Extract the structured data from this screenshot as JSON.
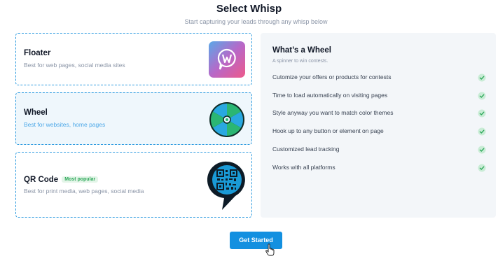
{
  "header": {
    "title": "Select Whisp",
    "subtitle": "Start capturing your leads through any whisp below"
  },
  "options": [
    {
      "title": "Floater",
      "description": "Best for web pages, social media sites",
      "icon": "floater-icon",
      "selected": false
    },
    {
      "title": "Wheel",
      "description": "Best for websites, home pages",
      "icon": "wheel-icon",
      "selected": true
    },
    {
      "title": "QR Code",
      "badge": "Most popular",
      "description": "Best for print media, web pages, social media",
      "icon": "qr-code-icon",
      "selected": false
    }
  ],
  "details": {
    "title": "What’s a Wheel",
    "subtitle": "A spinner to win contests.",
    "features": [
      "Cutomize your offers or products for contests",
      "Time to load automatically on visiting pages",
      "Style anyway you want to match color themes",
      "Hook up to any button or element on page",
      "Customized lead tracking",
      "Works with all platforms"
    ]
  },
  "actions": {
    "get_started": "Get Started"
  },
  "colors": {
    "accent": "#1390e0",
    "border": "#2f9ce0",
    "check": "#4cc27a",
    "panel": "#f3f6f9"
  }
}
